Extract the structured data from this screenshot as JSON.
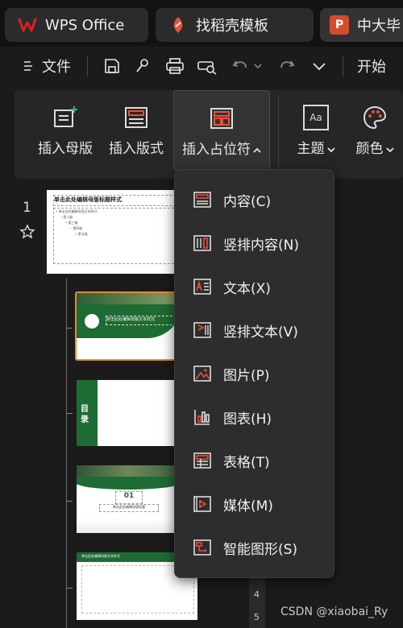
{
  "tabs": [
    {
      "label": "WPS Office",
      "logo": "W"
    },
    {
      "label": "找稻壳模板"
    },
    {
      "label": "中大毕",
      "logo": "P"
    }
  ],
  "menu": {
    "file": "文件",
    "start": "开始"
  },
  "ribbon": {
    "insert_master": "插入母版",
    "insert_layout": "插入版式",
    "insert_placeholder": "插入占位符",
    "theme": "主题",
    "color": "颜色",
    "aa": "Aa"
  },
  "slides": {
    "number": "1",
    "master_title": "单击此处编辑母版标题样式",
    "master_body": [
      "• 单击此处编辑母版文本样式",
      "– 第二级",
      "• 第三级",
      "– 第四级",
      "» 第五级"
    ],
    "layout1_title": "单击此处编辑母版文本样式",
    "layout2_title": "目录",
    "layout3_number": "01",
    "layout3_title": "单击此处编辑母版标题",
    "layout4_title": "单击此处编辑母版文本样式"
  },
  "dropdown": [
    {
      "label": "内容(C)",
      "icon": "content-placeholder-icon"
    },
    {
      "label": "竖排内容(N)",
      "icon": "vertical-content-icon"
    },
    {
      "label": "文本(X)",
      "icon": "text-placeholder-icon"
    },
    {
      "label": "竖排文本(V)",
      "icon": "vertical-text-icon"
    },
    {
      "label": "图片(P)",
      "icon": "picture-icon"
    },
    {
      "label": "图表(H)",
      "icon": "chart-icon"
    },
    {
      "label": "表格(T)",
      "icon": "table-icon"
    },
    {
      "label": "媒体(M)",
      "icon": "media-icon"
    },
    {
      "label": "智能图形(S)",
      "icon": "smartart-icon"
    }
  ],
  "ruler_labels": [
    "4",
    "5"
  ],
  "watermark": "CSDN @xiaobai_Ry",
  "colors": {
    "accent": "#e8503a",
    "wps_red": "#e02020",
    "ppt_red": "#d64a2f",
    "green": "#1f6b34",
    "orange": "#e88a2a"
  }
}
